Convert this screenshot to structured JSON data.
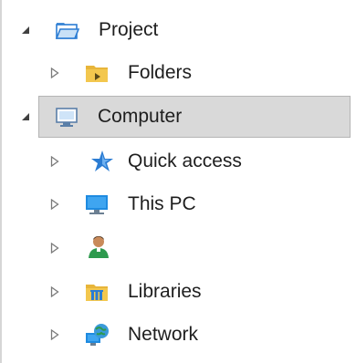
{
  "tree": {
    "items": [
      {
        "label": "Project",
        "level": 0,
        "expanded": true,
        "icon": "folder-open-icon"
      },
      {
        "label": "Folders",
        "level": 1,
        "expanded": false,
        "icon": "folder-icon"
      },
      {
        "label": "Computer",
        "level": 0,
        "expanded": true,
        "selected": true,
        "icon": "computer-icon"
      },
      {
        "label": "Quick access",
        "level": 1,
        "expanded": false,
        "icon": "star-icon"
      },
      {
        "label": "This PC",
        "level": 1,
        "expanded": false,
        "icon": "monitor-icon"
      },
      {
        "label": "",
        "level": 1,
        "expanded": false,
        "icon": "user-icon"
      },
      {
        "label": "Libraries",
        "level": 1,
        "expanded": false,
        "icon": "library-icon"
      },
      {
        "label": "Network",
        "level": 1,
        "expanded": false,
        "icon": "network-icon"
      }
    ]
  },
  "colors": {
    "selection_bg": "#d9d9d9",
    "selection_border": "#b4b4b4",
    "text": "#1e1e1e",
    "folder_yellow": "#f3c74e",
    "accent_blue": "#2b7cd3"
  }
}
